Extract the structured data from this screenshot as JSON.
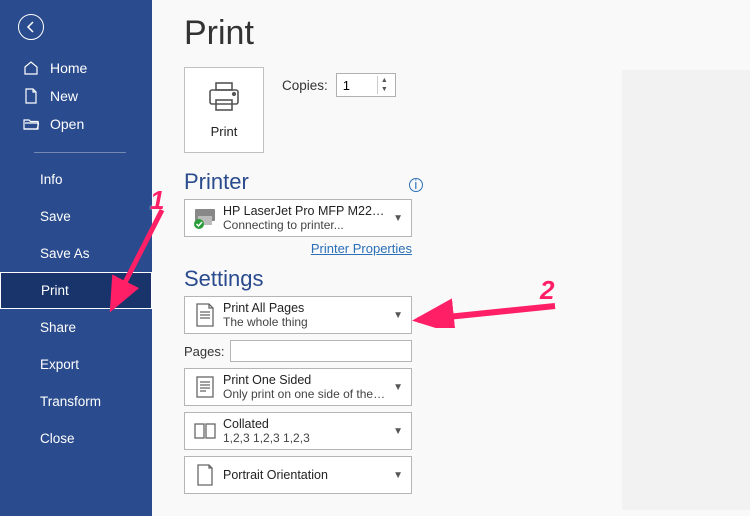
{
  "sidebar": {
    "primary": [
      {
        "label": "Home",
        "icon": "home"
      },
      {
        "label": "New",
        "icon": "doc"
      },
      {
        "label": "Open",
        "icon": "folder"
      }
    ],
    "secondary": [
      {
        "label": "Info"
      },
      {
        "label": "Save"
      },
      {
        "label": "Save As"
      },
      {
        "label": "Print",
        "active": true
      },
      {
        "label": "Share"
      },
      {
        "label": "Export"
      },
      {
        "label": "Transform"
      },
      {
        "label": "Close"
      }
    ]
  },
  "page": {
    "title": "Print"
  },
  "print_button": {
    "label": "Print"
  },
  "copies": {
    "label": "Copies:",
    "value": "1"
  },
  "printer": {
    "heading": "Printer",
    "name": "HP LaserJet Pro MFP M225d…",
    "status": "Connecting to printer...",
    "properties_link": "Printer Properties"
  },
  "settings": {
    "heading": "Settings",
    "print_scope": {
      "line1": "Print All Pages",
      "line2": "The whole thing"
    },
    "pages_label": "Pages:",
    "pages_value": "",
    "sides": {
      "line1": "Print One Sided",
      "line2": "Only print on one side of the…"
    },
    "collate": {
      "line1": "Collated",
      "line2": "1,2,3    1,2,3    1,2,3"
    },
    "orientation": {
      "line1": "Portrait Orientation"
    }
  },
  "annotations": {
    "one": "1",
    "two": "2"
  }
}
